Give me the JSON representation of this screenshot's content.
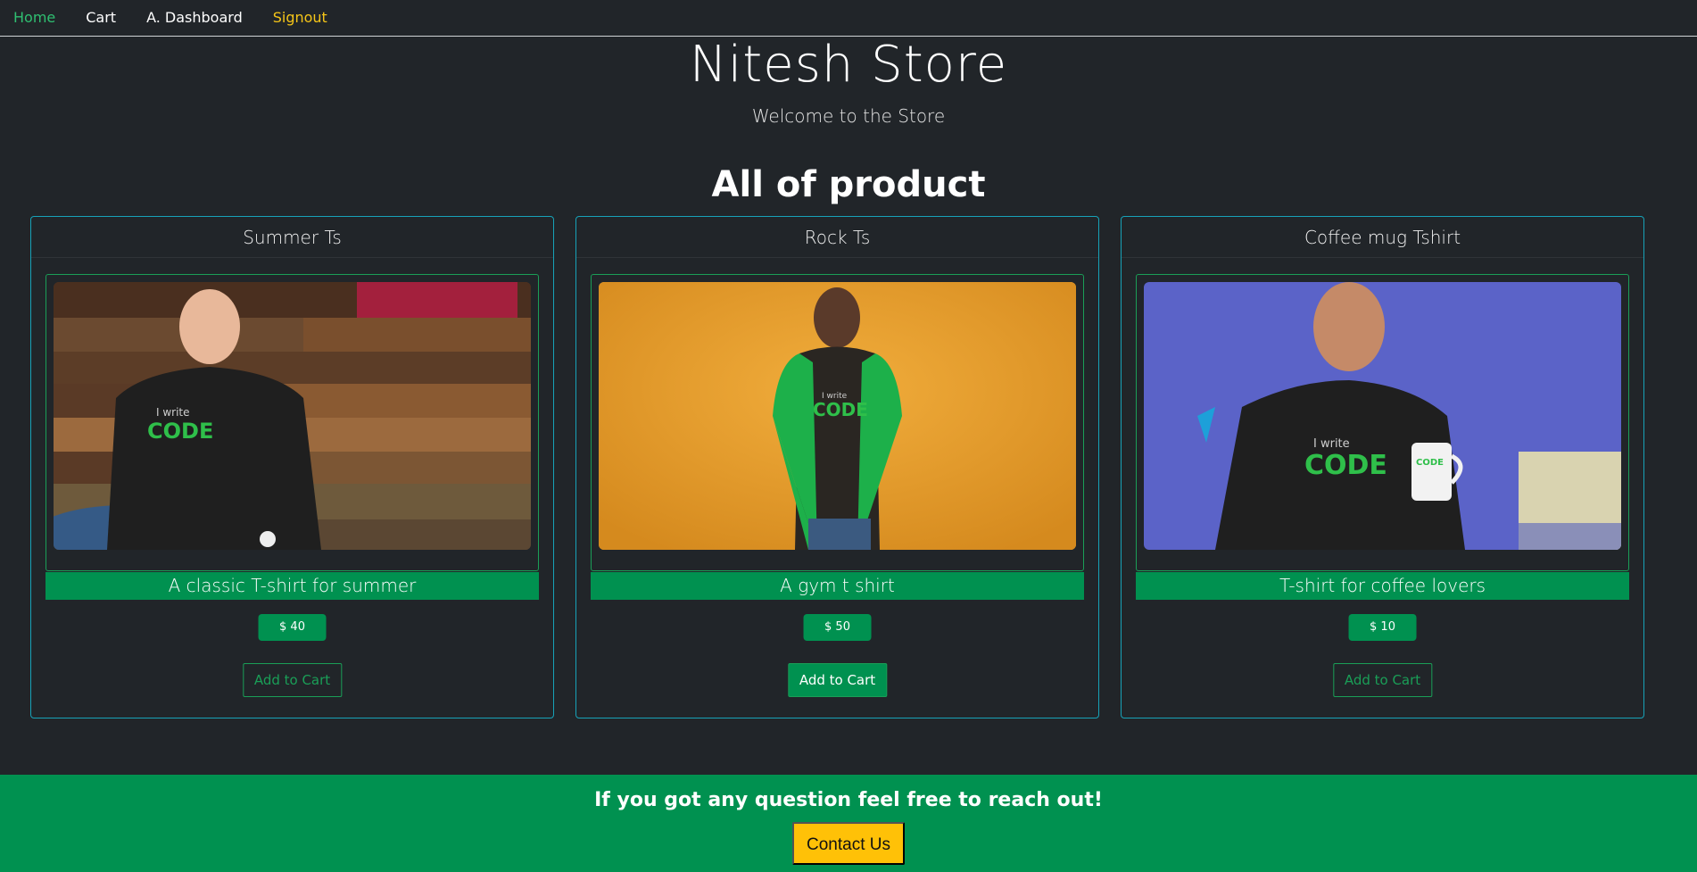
{
  "nav": {
    "home": "Home",
    "cart": "Cart",
    "dashboard": "A. Dashboard",
    "signout": "Signout"
  },
  "header": {
    "title": "Nitesh Store",
    "subtitle": "Welcome to the Store"
  },
  "section": {
    "title": "All of product"
  },
  "products": [
    {
      "name": "Summer Ts",
      "description": "A classic T-shirt for summer",
      "price": "$ 40",
      "button": "Add to Cart",
      "image": "man-black-tshirt-wood-wall"
    },
    {
      "name": "Rock Ts",
      "description": "A gym t shirt",
      "price": "$ 50",
      "button": "Add to Cart",
      "image": "man-raglan-tshirt-orange-wall"
    },
    {
      "name": "Coffee mug Tshirt",
      "description": "T-shirt for coffee lovers",
      "price": "$ 10",
      "button": "Add to Cart",
      "image": "man-tshirt-coffee-mug-blue-wall"
    }
  ],
  "footer": {
    "text": "If you got any question feel free to reach out!",
    "button": "Contact Us"
  },
  "colors": {
    "background": "#212529",
    "accent_green": "#009150",
    "card_border": "#17a2b8",
    "signout": "#f5c518",
    "contact_button": "#ffc107"
  }
}
